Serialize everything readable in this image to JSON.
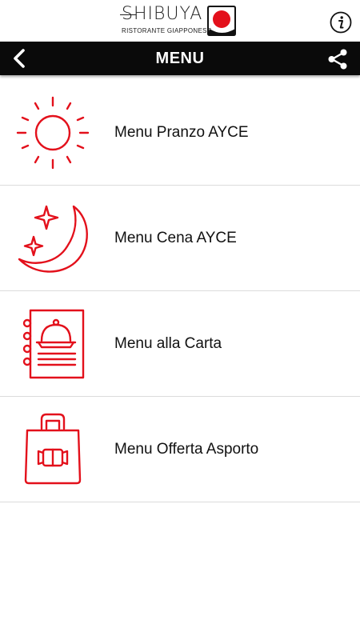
{
  "brand": {
    "name": "SHIBUYA",
    "subtitle": "RISTORANTE GIAPPONESE",
    "accent_color": "#e3101b"
  },
  "header": {
    "info_icon": "info-icon"
  },
  "navbar": {
    "title": "MENU",
    "back_icon": "chevron-left-icon",
    "share_icon": "share-icon"
  },
  "menu": {
    "items": [
      {
        "label": "Menu Pranzo AYCE",
        "icon": "sun-icon"
      },
      {
        "label": "Menu Cena AYCE",
        "icon": "moon-stars-icon"
      },
      {
        "label": "Menu alla Carta",
        "icon": "menu-book-icon"
      },
      {
        "label": "Menu Offerta Asporto",
        "icon": "takeaway-bag-icon"
      }
    ]
  }
}
